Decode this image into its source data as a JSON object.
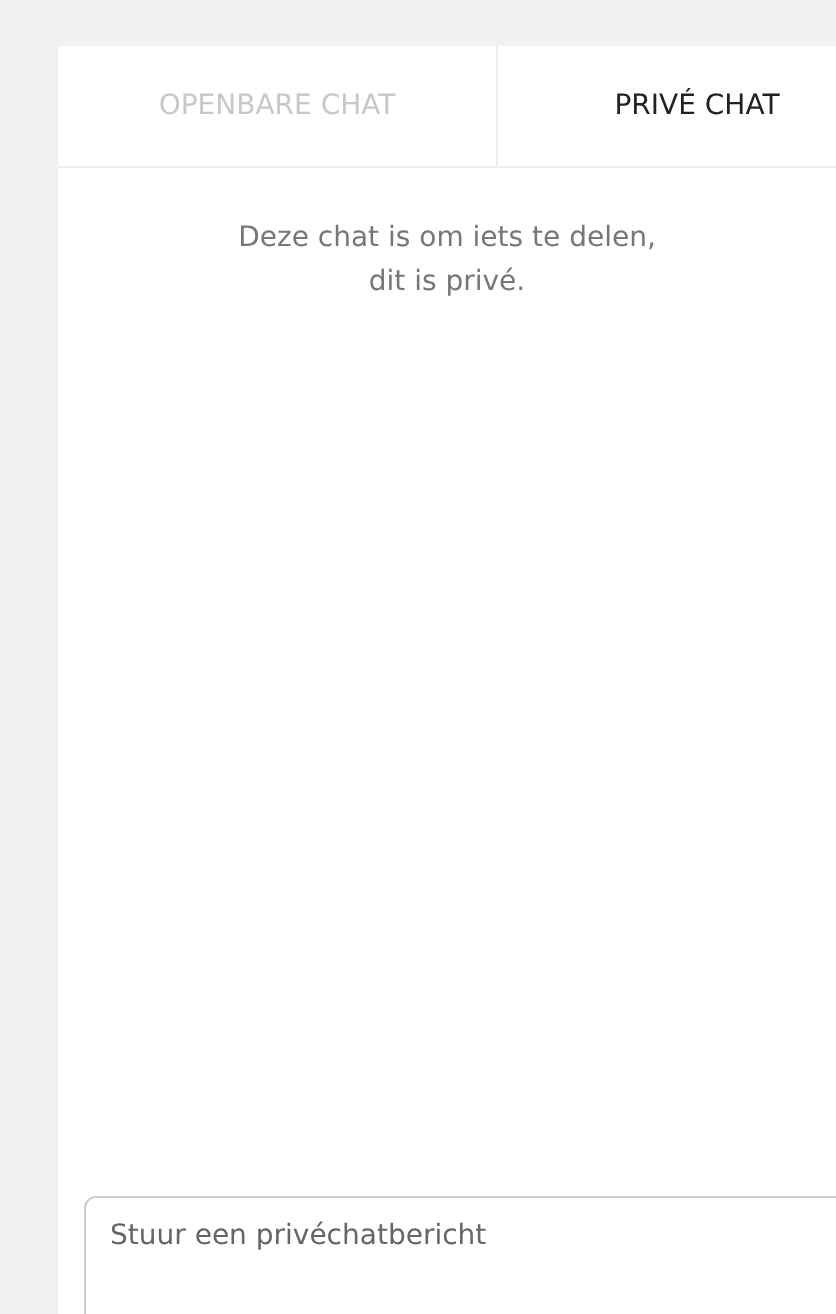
{
  "tabs": [
    {
      "label": "OPENBARE CHAT",
      "selected": false
    },
    {
      "label": "PRIVÉ CHAT",
      "selected": true
    }
  ],
  "notice": [
    "Deze chat is om iets te delen,",
    "dit is privé."
  ],
  "message_input": {
    "placeholder": "Stuur een privéchatbericht"
  }
}
